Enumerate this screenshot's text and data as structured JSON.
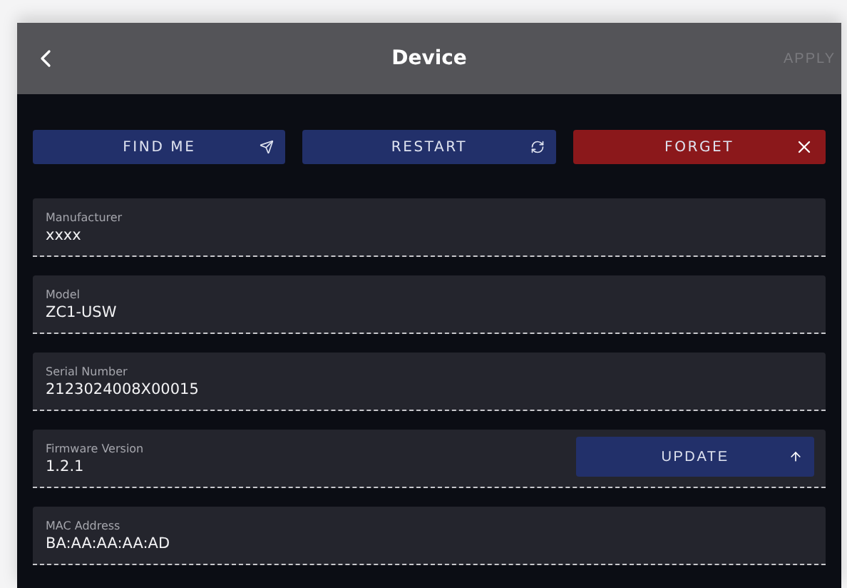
{
  "header": {
    "title": "Device",
    "apply": {
      "label": "APPLY",
      "disabled": true
    }
  },
  "actions": [
    {
      "label": "FIND ME",
      "kind": "locate",
      "danger": false
    },
    {
      "label": "RESTART",
      "kind": "restart",
      "danger": false
    },
    {
      "label": "FORGET",
      "kind": "forget",
      "danger": true
    }
  ],
  "fields": [
    {
      "label": "Manufacturer",
      "value": "xxxx"
    },
    {
      "label": "Model",
      "value": "ZC1-USW"
    },
    {
      "label": "Serial Number",
      "value": "2123024008X00015"
    },
    {
      "label": "Firmware Version",
      "value": "1.2.1",
      "action": {
        "label": "UPDATE",
        "kind": "update"
      }
    },
    {
      "label": "MAC Address",
      "value": "BA:AA:AA:AA:AD"
    }
  ]
}
